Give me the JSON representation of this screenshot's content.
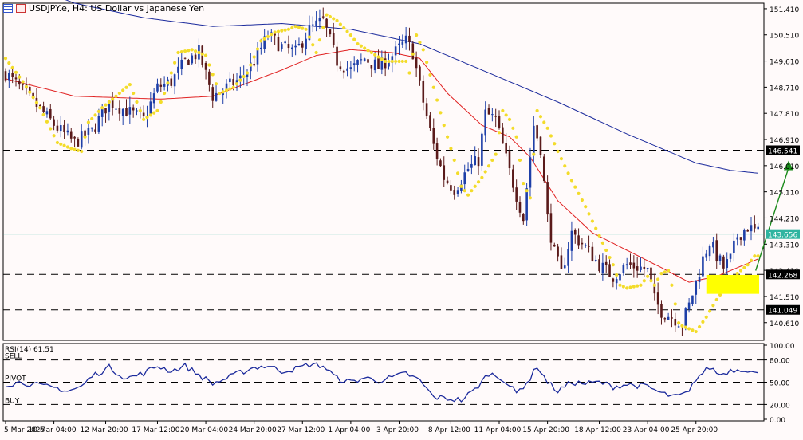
{
  "header": {
    "title": "USDJPY.e, H4:  US Dollar vs Japanese Yen",
    "rsi_label": "RSI(14) 61.51"
  },
  "colors": {
    "background": "#fffafa",
    "bull": "#1e3fa8",
    "bear": "#5a1a1a",
    "ma_fast": "#e02020",
    "ma_slow": "#1b2a9c",
    "sar": "#f3dc2a",
    "zone": "#ffff00",
    "arrow": "#1a8a1a",
    "current_line": "#2fb4a0",
    "rsi": "#1b2a9c"
  },
  "chart_data": {
    "type": "candlestick",
    "symbol": "USDJPY.e",
    "timeframe": "H4",
    "ylim": [
      140.0,
      151.6
    ],
    "y_ticks": [
      "151.410",
      "150.510",
      "149.610",
      "148.710",
      "147.810",
      "146.910",
      "146.010",
      "145.110",
      "144.210",
      "143.310",
      "142.410",
      "141.510",
      "140.610"
    ],
    "x_labels": [
      "5 Mar 2025",
      "10 Mar 04:00",
      "12 Mar 20:00",
      "17 Mar 12:00",
      "20 Mar 04:00",
      "24 Mar 20:00",
      "27 Mar 12:00",
      "1 Apr 04:00",
      "3 Apr 20:00",
      "8 Apr 12:00",
      "11 Apr 04:00",
      "15 Apr 20:00",
      "18 Apr 12:00",
      "23 Apr 04:00",
      "25 Apr 20:00"
    ],
    "horizontal_levels": [
      {
        "label": "146.541",
        "value": 146.541,
        "style": "dashed"
      },
      {
        "label": "142.268",
        "value": 142.268,
        "style": "dashed"
      },
      {
        "label": "141.049",
        "value": 141.049,
        "style": "dashed"
      }
    ],
    "current_price": {
      "label": "143.656",
      "value": 143.656
    },
    "support_zone": {
      "from": 141.6,
      "to": 142.25
    },
    "close_anchors": [
      [
        0,
        149.2
      ],
      [
        8,
        148.2
      ],
      [
        15,
        147.3
      ],
      [
        20,
        146.8
      ],
      [
        25,
        147.2
      ],
      [
        30,
        148.2
      ],
      [
        35,
        147.9
      ],
      [
        40,
        147.6
      ],
      [
        44,
        148.7
      ],
      [
        48,
        148.9
      ],
      [
        52,
        149.6
      ],
      [
        56,
        149.9
      ],
      [
        60,
        148.4
      ],
      [
        64,
        148.7
      ],
      [
        68,
        149.0
      ],
      [
        72,
        149.6
      ],
      [
        76,
        150.5
      ],
      [
        80,
        150.1
      ],
      [
        84,
        149.9
      ],
      [
        88,
        150.7
      ],
      [
        92,
        151.0
      ],
      [
        96,
        149.6
      ],
      [
        100,
        149.3
      ],
      [
        104,
        149.7
      ],
      [
        108,
        149.4
      ],
      [
        112,
        149.8
      ],
      [
        116,
        150.3
      ],
      [
        118,
        149.9
      ],
      [
        121,
        148.2
      ],
      [
        124,
        146.7
      ],
      [
        127,
        145.6
      ],
      [
        130,
        145.2
      ],
      [
        134,
        145.9
      ],
      [
        137,
        146.2
      ],
      [
        139,
        147.8
      ],
      [
        142,
        147.6
      ],
      [
        146,
        145.8
      ],
      [
        148,
        145.0
      ],
      [
        150,
        144.2
      ],
      [
        153,
        147.4
      ],
      [
        155,
        146.6
      ],
      [
        157,
        144.2
      ],
      [
        159,
        143.0
      ],
      [
        161,
        142.3
      ],
      [
        164,
        143.7
      ],
      [
        168,
        143.2
      ],
      [
        172,
        142.6
      ],
      [
        176,
        142.2
      ],
      [
        180,
        142.6
      ],
      [
        184,
        142.5
      ],
      [
        186,
        142.4
      ],
      [
        188,
        141.4
      ],
      [
        190,
        141.0
      ],
      [
        193,
        140.8
      ],
      [
        196,
        140.6
      ],
      [
        198,
        141.2
      ],
      [
        200,
        142.0
      ],
      [
        202,
        142.8
      ],
      [
        204,
        143.4
      ],
      [
        206,
        142.9
      ],
      [
        208,
        142.5
      ],
      [
        210,
        142.8
      ],
      [
        212,
        143.6
      ],
      [
        215,
        143.9
      ],
      [
        218,
        143.7
      ]
    ],
    "sar_anchors": [
      [
        0,
        149.7
      ],
      [
        5,
        148.9
      ],
      [
        10,
        148.0
      ],
      [
        15,
        146.8
      ],
      [
        19,
        146.6
      ],
      [
        22,
        146.5
      ],
      [
        24,
        147.5
      ],
      [
        28,
        148.0
      ],
      [
        32,
        148.4
      ],
      [
        36,
        148.8
      ],
      [
        40,
        147.6
      ],
      [
        44,
        147.9
      ],
      [
        46,
        148.5
      ],
      [
        50,
        149.9
      ],
      [
        54,
        150.0
      ],
      [
        58,
        149.8
      ],
      [
        62,
        148.5
      ],
      [
        66,
        148.7
      ],
      [
        70,
        149.2
      ],
      [
        74,
        150.3
      ],
      [
        78,
        150.6
      ],
      [
        82,
        150.7
      ],
      [
        84,
        150.8
      ],
      [
        87,
        150.7
      ],
      [
        90,
        149.9
      ],
      [
        93,
        151.2
      ],
      [
        96,
        151.0
      ],
      [
        100,
        150.5
      ],
      [
        102,
        150.2
      ],
      [
        106,
        149.9
      ],
      [
        110,
        149.6
      ],
      [
        112,
        149.6
      ],
      [
        116,
        149.6
      ],
      [
        117,
        149.2
      ],
      [
        119,
        150.5
      ],
      [
        121,
        150.0
      ],
      [
        124,
        148.7
      ],
      [
        127,
        147.4
      ],
      [
        130,
        146.2
      ],
      [
        132,
        145.3
      ],
      [
        134,
        145.0
      ],
      [
        138,
        145.6
      ],
      [
        142,
        146.4
      ],
      [
        144,
        147.9
      ],
      [
        146,
        147.6
      ],
      [
        148,
        147.0
      ],
      [
        150,
        145.4
      ],
      [
        152,
        144.9
      ],
      [
        154,
        147.9
      ],
      [
        157,
        147.3
      ],
      [
        160,
        146.5
      ],
      [
        164,
        145.5
      ],
      [
        168,
        144.6
      ],
      [
        172,
        143.6
      ],
      [
        176,
        142.6
      ],
      [
        178,
        141.9
      ],
      [
        180,
        141.8
      ],
      [
        184,
        141.9
      ],
      [
        186,
        142.2
      ],
      [
        188,
        141.9
      ],
      [
        190,
        142.3
      ],
      [
        192,
        142.4
      ],
      [
        193,
        141.9
      ],
      [
        195,
        140.6
      ],
      [
        196,
        140.5
      ],
      [
        198,
        140.4
      ],
      [
        200,
        140.3
      ],
      [
        203,
        140.8
      ],
      [
        206,
        141.4
      ],
      [
        209,
        141.9
      ],
      [
        212,
        142.3
      ],
      [
        215,
        142.6
      ],
      [
        217,
        142.9
      ]
    ],
    "ma_fast_anchors": [
      [
        0,
        149.0
      ],
      [
        20,
        148.4
      ],
      [
        45,
        148.3
      ],
      [
        60,
        148.4
      ],
      [
        80,
        149.3
      ],
      [
        90,
        149.8
      ],
      [
        100,
        150.0
      ],
      [
        112,
        149.9
      ],
      [
        120,
        149.7
      ],
      [
        128,
        148.5
      ],
      [
        138,
        147.4
      ],
      [
        146,
        147.0
      ],
      [
        152,
        146.3
      ],
      [
        160,
        144.8
      ],
      [
        170,
        143.7
      ],
      [
        180,
        143.1
      ],
      [
        190,
        142.5
      ],
      [
        198,
        142.0
      ],
      [
        206,
        142.2
      ],
      [
        212,
        142.5
      ],
      [
        218,
        142.8
      ]
    ],
    "ma_slow_anchors": [
      [
        0,
        152.5
      ],
      [
        20,
        151.6
      ],
      [
        40,
        151.1
      ],
      [
        60,
        150.8
      ],
      [
        80,
        150.9
      ],
      [
        100,
        150.7
      ],
      [
        120,
        150.2
      ],
      [
        140,
        149.2
      ],
      [
        160,
        148.2
      ],
      [
        180,
        147.1
      ],
      [
        190,
        146.6
      ],
      [
        200,
        146.1
      ],
      [
        210,
        145.85
      ],
      [
        218,
        145.75
      ]
    ],
    "rsi": {
      "levels": [
        "100.00",
        "80.00",
        "50.00",
        "20.00",
        "0.00"
      ],
      "level_labels": [
        "SELL",
        "PIVOT",
        "BUY"
      ],
      "anchors": [
        [
          0,
          47
        ],
        [
          5,
          50
        ],
        [
          10,
          45
        ],
        [
          15,
          42
        ],
        [
          18,
          38
        ],
        [
          22,
          44
        ],
        [
          25,
          58
        ],
        [
          30,
          70
        ],
        [
          35,
          55
        ],
        [
          40,
          62
        ],
        [
          44,
          72
        ],
        [
          48,
          65
        ],
        [
          52,
          72
        ],
        [
          56,
          60
        ],
        [
          60,
          48
        ],
        [
          64,
          55
        ],
        [
          68,
          63
        ],
        [
          72,
          70
        ],
        [
          76,
          72
        ],
        [
          80,
          65
        ],
        [
          84,
          68
        ],
        [
          88,
          74
        ],
        [
          92,
          72
        ],
        [
          96,
          55
        ],
        [
          100,
          50
        ],
        [
          104,
          56
        ],
        [
          108,
          52
        ],
        [
          112,
          56
        ],
        [
          116,
          62
        ],
        [
          120,
          52
        ],
        [
          124,
          30
        ],
        [
          128,
          28
        ],
        [
          132,
          26
        ],
        [
          136,
          40
        ],
        [
          140,
          62
        ],
        [
          144,
          55
        ],
        [
          148,
          35
        ],
        [
          152,
          55
        ],
        [
          154,
          72
        ],
        [
          157,
          50
        ],
        [
          160,
          38
        ],
        [
          164,
          50
        ],
        [
          168,
          48
        ],
        [
          172,
          50
        ],
        [
          176,
          44
        ],
        [
          180,
          47
        ],
        [
          186,
          44
        ],
        [
          190,
          35
        ],
        [
          194,
          30
        ],
        [
          198,
          36
        ],
        [
          200,
          55
        ],
        [
          204,
          70
        ],
        [
          207,
          60
        ],
        [
          210,
          66
        ],
        [
          214,
          68
        ],
        [
          218,
          60
        ]
      ],
      "value": 61.51
    }
  }
}
